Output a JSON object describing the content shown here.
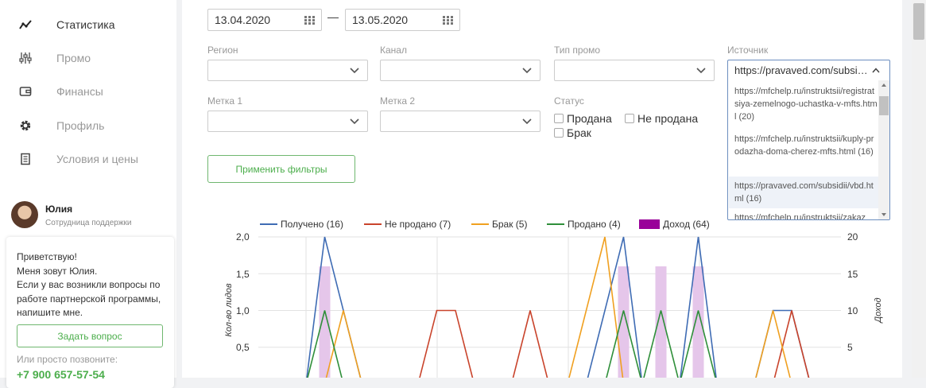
{
  "sidebar": {
    "items": [
      {
        "label": "Статистика",
        "icon": "stats-chart-icon",
        "active": true
      },
      {
        "label": "Промо",
        "icon": "sliders-icon",
        "active": false
      },
      {
        "label": "Финансы",
        "icon": "wallet-icon",
        "active": false
      },
      {
        "label": "Профиль",
        "icon": "gear-icon",
        "active": false
      },
      {
        "label": "Условия и цены",
        "icon": "document-icon",
        "active": false
      }
    ],
    "user": {
      "name": "Юлия",
      "role": "Сотрудница поддержки"
    },
    "support": {
      "text": "Приветствую!\nМеня зовут Юлия.\nЕсли у вас возникли вопросы по работе партнерской программы, напишите мне.",
      "ask_label": "Задать вопрос",
      "call_text": "Или просто позвоните:",
      "phone": "+7 900 657-57-54"
    }
  },
  "filters": {
    "date_from": "13.04.2020",
    "date_to": "13.05.2020",
    "date_separator": "—",
    "region_label": "Регион",
    "channel_label": "Канал",
    "promo_type_label": "Тип промо",
    "source_label": "Источник",
    "tag1_label": "Метка 1",
    "tag2_label": "Метка 2",
    "status_label": "Статус",
    "status_options": [
      "Продана",
      "Не продана",
      "Брак"
    ],
    "apply_label": "Применить фильтры",
    "source": {
      "selected": "https://pravaved.com/subsidii/vbd.html",
      "options": [
        "https://mfchelp.ru/instruktsii/registratsiya-zemelnogo-uchastka-v-mfts.html (20)",
        "https://mfchelp.ru/instruktsii/kuply-prodazha-doma-cherez-mfts.html (16)",
        "https://pravaved.com/subsidii/vbd.html (16)",
        "https://mfchelp.ru/instruktsii/zakaz"
      ]
    }
  },
  "colors": {
    "received": "#3f6cb4",
    "not_sold": "#c9442c",
    "defect": "#f0a020",
    "sold": "#2f8f3a",
    "income": "#990099",
    "income_bar": "#e5c6ea",
    "accent_green": "#4cae4c"
  },
  "chart_data": {
    "type": "line",
    "legend": [
      {
        "name": "Получено (16)",
        "kind": "line",
        "color": "#3f6cb4"
      },
      {
        "name": "Не продано (7)",
        "kind": "line",
        "color": "#c9442c"
      },
      {
        "name": "Брак (5)",
        "kind": "line",
        "color": "#f0a020"
      },
      {
        "name": "Продано (4)",
        "kind": "line",
        "color": "#2f8f3a"
      },
      {
        "name": "Доход (64)",
        "kind": "bar",
        "color": "#990099"
      }
    ],
    "ylabel": "Кол-во лидов",
    "y2label": "Доход",
    "ylim": [
      0,
      2
    ],
    "y2lim": [
      0,
      20
    ],
    "yticks": [
      "2,0",
      "1,5",
      "1,0",
      "0,5"
    ],
    "y2ticks": [
      "20",
      "15",
      "10",
      "5"
    ],
    "x": [
      0,
      1,
      2,
      3,
      4,
      5,
      6,
      7,
      8,
      9,
      10,
      11,
      12,
      13,
      14,
      15,
      16,
      17,
      18,
      19,
      20,
      21,
      22,
      23,
      24,
      25,
      26,
      27
    ],
    "series": [
      {
        "name": "Получено (16)",
        "values": [
          0,
          2,
          1,
          0,
          0,
          0,
          0,
          0,
          0,
          0,
          0,
          0,
          0,
          0,
          0,
          0,
          1,
          2,
          0,
          0,
          0,
          2,
          0,
          0,
          0,
          1,
          1,
          0
        ]
      },
      {
        "name": "Не продано (7)",
        "values": [
          0,
          0,
          0,
          0,
          0,
          0,
          0,
          1,
          1,
          0,
          0,
          0,
          1,
          0,
          0,
          0,
          0,
          0,
          0,
          0,
          0,
          0,
          0,
          0,
          0,
          0,
          1,
          0
        ]
      },
      {
        "name": "Брак (5)",
        "values": [
          0,
          0,
          1,
          0,
          0,
          0,
          0,
          0,
          0,
          0,
          0,
          0,
          0,
          0,
          0,
          1,
          2,
          0,
          0,
          0,
          0,
          0,
          0,
          0,
          0,
          1,
          0,
          0
        ]
      },
      {
        "name": "Продано (4)",
        "values": [
          0,
          1,
          0,
          0,
          0,
          0,
          0,
          0,
          0,
          0,
          0,
          0,
          0,
          0,
          0,
          0,
          0,
          1,
          0,
          1,
          0,
          1,
          0,
          0,
          0,
          0,
          0,
          0
        ]
      },
      {
        "name": "Доход (64)",
        "values": [
          0,
          16,
          0,
          0,
          0,
          0,
          0,
          0,
          0,
          0,
          0,
          0,
          0,
          0,
          0,
          0,
          0,
          16,
          0,
          16,
          0,
          16,
          0,
          0,
          0,
          0,
          0,
          0
        ]
      }
    ]
  }
}
